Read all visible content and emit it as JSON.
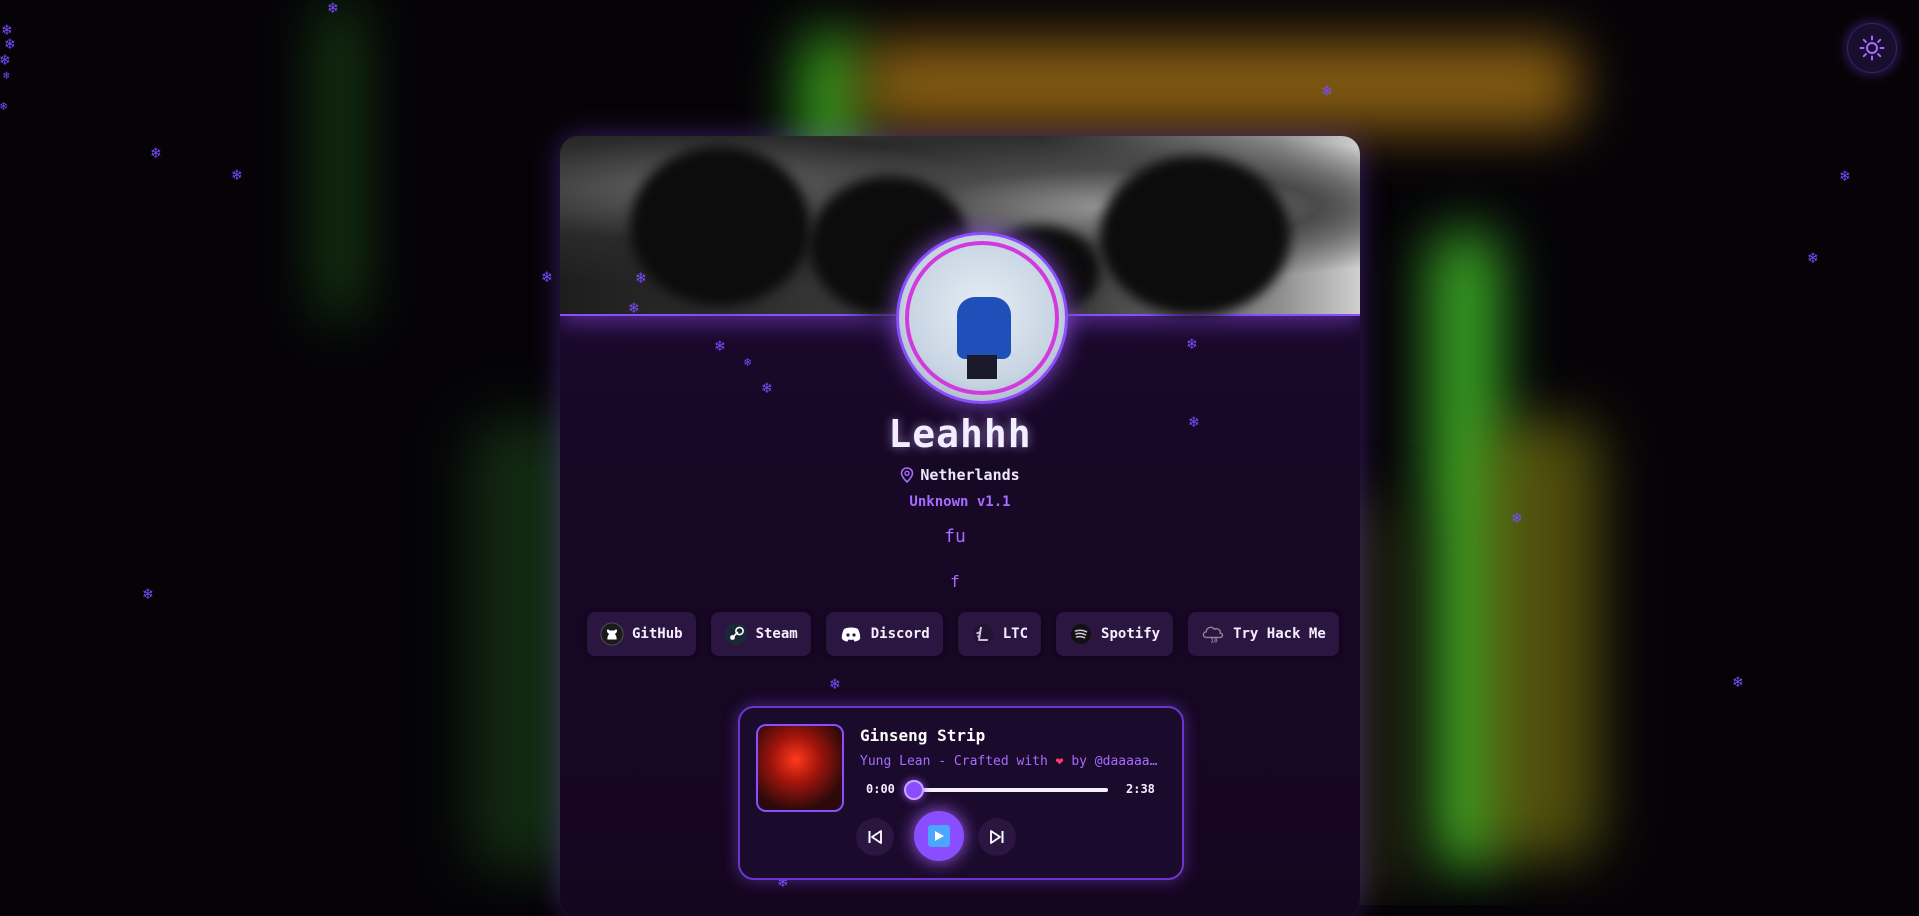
{
  "profile": {
    "name": "Leahhh",
    "location": "Netherlands",
    "version": "Unknown v1.1",
    "bio_line1": "fu",
    "bio_line2": "f"
  },
  "socials": [
    {
      "label": "GitHub",
      "icon": "github-icon"
    },
    {
      "label": "Steam",
      "icon": "steam-icon"
    },
    {
      "label": "Discord",
      "icon": "discord-icon"
    },
    {
      "label": "LTC",
      "icon": "litecoin-icon"
    },
    {
      "label": "Spotify",
      "icon": "spotify-icon"
    },
    {
      "label": "Try Hack Me",
      "icon": "tryhackme-icon"
    }
  ],
  "player": {
    "title": "Ginseng Strip",
    "artist_prefix": "Yung Lean - Crafted with",
    "artist_suffix": "by @daaaaan…",
    "current_time": "0:00",
    "duration": "2:38",
    "progress": 0
  },
  "colors": {
    "accent": "#8a4dff",
    "accent_text": "#a66bff",
    "card_bg": "#1c0a2e",
    "button_bg": "#2a1640"
  },
  "icons": {
    "theme_toggle": "sun-icon",
    "location": "location-pin-icon",
    "prev": "skip-back-icon",
    "play": "play-icon",
    "next": "skip-forward-icon"
  }
}
